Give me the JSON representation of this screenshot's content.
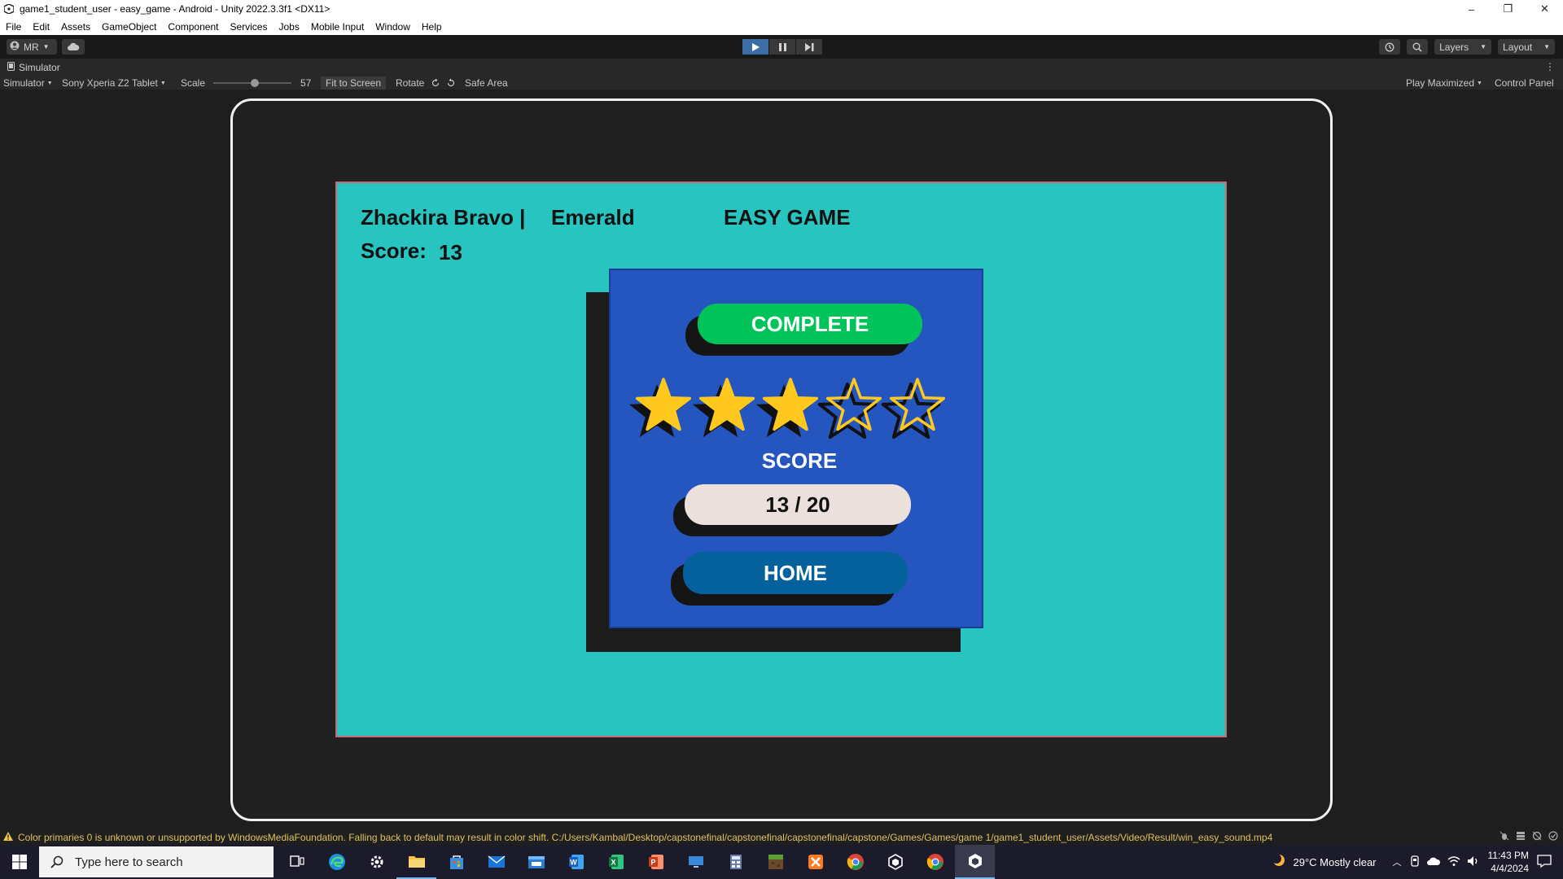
{
  "window": {
    "title": "game1_student_user - easy_game - Android - Unity 2022.3.3f1 <DX11>",
    "controls": [
      "–",
      "❐",
      "✕"
    ]
  },
  "menu": [
    "File",
    "Edit",
    "Assets",
    "GameObject",
    "Component",
    "Services",
    "Jobs",
    "Mobile Input",
    "Window",
    "Help"
  ],
  "toolbar": {
    "account": "MR",
    "layers": "Layers",
    "layout": "Layout",
    "play_state": "playing"
  },
  "simulator": {
    "tab": "Simulator",
    "mode": "Simulator",
    "device": "Sony Xperia Z2 Tablet",
    "scale_label": "Scale",
    "scale_value": "57",
    "fit_to_screen": "Fit to Screen",
    "rotate": "Rotate",
    "safe_area": "Safe Area",
    "play_maximized": "Play Maximized",
    "control_panel": "Control Panel"
  },
  "game": {
    "player_name": "Zhackira Bravo |",
    "section": "Emerald",
    "mode": "EASY GAME",
    "score_label": "Score:",
    "score_value": "13",
    "status": "COMPLETE",
    "stars_filled": 3,
    "stars_total": 5,
    "score_heading": "SCORE",
    "result": "13 / 20",
    "home_button": "HOME",
    "colors": {
      "background": "#28c4bf",
      "panel": "#2556bf",
      "complete": "#00c35a",
      "home": "#05609e",
      "star": "#ffc81e"
    }
  },
  "status_bar": {
    "message": "Color primaries 0 is unknown or unsupported by WindowsMediaFoundation. Falling back to default may result in color shift. C:/Users/Kambal/Desktop/capstonefinal/capstonefinal/capstonefinal/capstone/Games/Games/game 1/game1_student_user/Assets/Video/Result/win_easy_sound.mp4"
  },
  "taskbar": {
    "search_placeholder": "Type here to search",
    "weather": "29°C  Mostly clear",
    "time": "11:43 PM",
    "date": "4/4/2024"
  }
}
